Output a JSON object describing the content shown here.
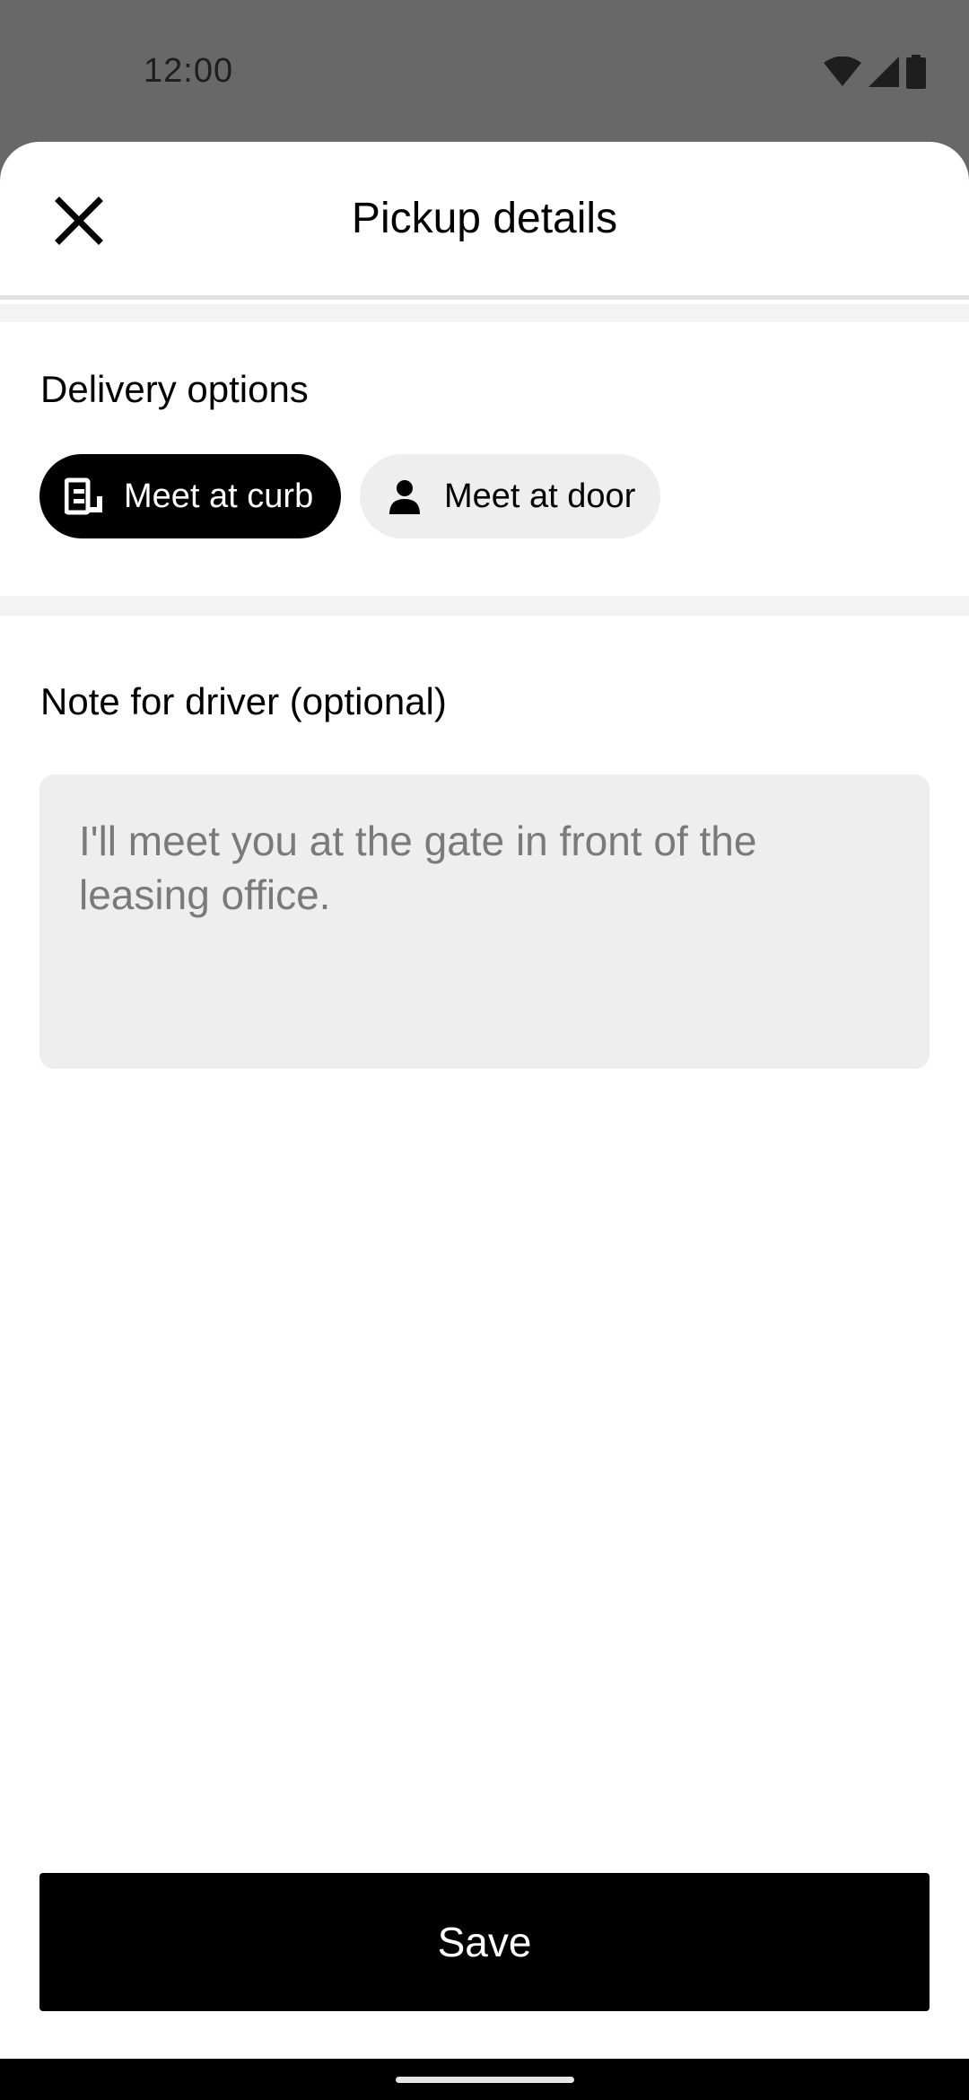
{
  "status_bar": {
    "time": "12:00",
    "icons": [
      "wifi-icon",
      "cellular-signal-icon",
      "battery-icon"
    ]
  },
  "header": {
    "title": "Pickup details",
    "close_icon": "close-icon"
  },
  "delivery_options": {
    "heading": "Delivery options",
    "options": [
      {
        "label": "Meet at curb",
        "icon": "curb-icon",
        "selected": true
      },
      {
        "label": "Meet at door",
        "icon": "person-icon",
        "selected": false
      }
    ]
  },
  "note": {
    "heading": "Note for driver (optional)",
    "value": "",
    "placeholder": "I'll meet you at the gate in front of the leasing office."
  },
  "actions": {
    "save_label": "Save"
  },
  "colors": {
    "scrim": "#686868",
    "primary": "#000000",
    "chip_unselected": "#eeeeee",
    "input_bg": "#eeeeee",
    "divider": "#f3f3f3"
  }
}
